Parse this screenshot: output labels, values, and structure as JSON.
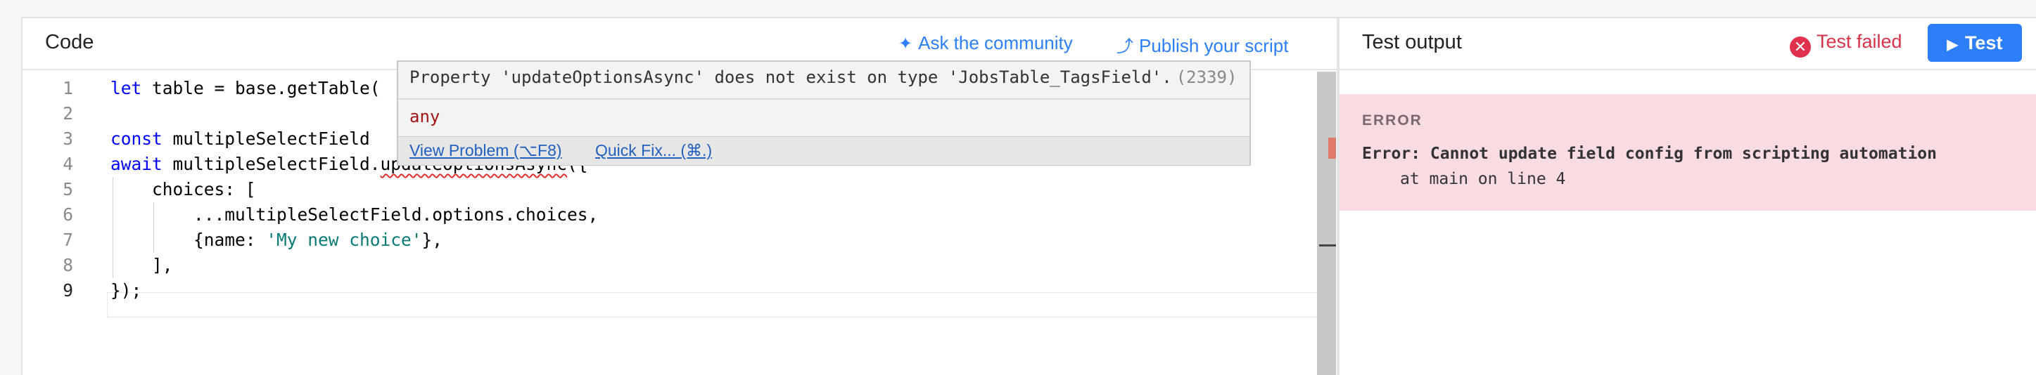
{
  "code_panel": {
    "title": "Code",
    "ask_link": "Ask the community",
    "publish_link": "Publish your script",
    "line_numbers": [
      "1",
      "2",
      "3",
      "4",
      "5",
      "6",
      "7",
      "8",
      "9"
    ],
    "lines": {
      "l1_kw": "let",
      "l1_rest": " table = base.getTable(",
      "l3_kw": "const",
      "l3_rest": " multipleSelectField ",
      "l4_kw": "await",
      "l4_pre": " multipleSelectField.",
      "l4_method": "updateOptionsAsync",
      "l4_post": "({",
      "l5": "    choices: [",
      "l6": "        ...multipleSelectField.options.choices,",
      "l7_pre": "        {name: ",
      "l7_str": "'My new choice'",
      "l7_post": "},",
      "l8": "    ],",
      "l9": "});"
    }
  },
  "hover": {
    "message": "Property 'updateOptionsAsync' does not exist on type 'JobsTable_TagsField'.",
    "error_code": "(2339)",
    "type_text": "any",
    "view_problem": "View Problem (⌥F8)",
    "quick_fix": "Quick Fix... (⌘.)"
  },
  "test_panel": {
    "title": "Test output",
    "status": "Test failed",
    "test_button": "Test",
    "error_label": "ERROR",
    "error_message": "Error: Cannot update field config from scripting automation",
    "error_trace": "at main on line 4"
  },
  "colors": {
    "accent": "#2d7ff9",
    "error": "#e0324d",
    "error_bg": "#f9dbe2"
  }
}
